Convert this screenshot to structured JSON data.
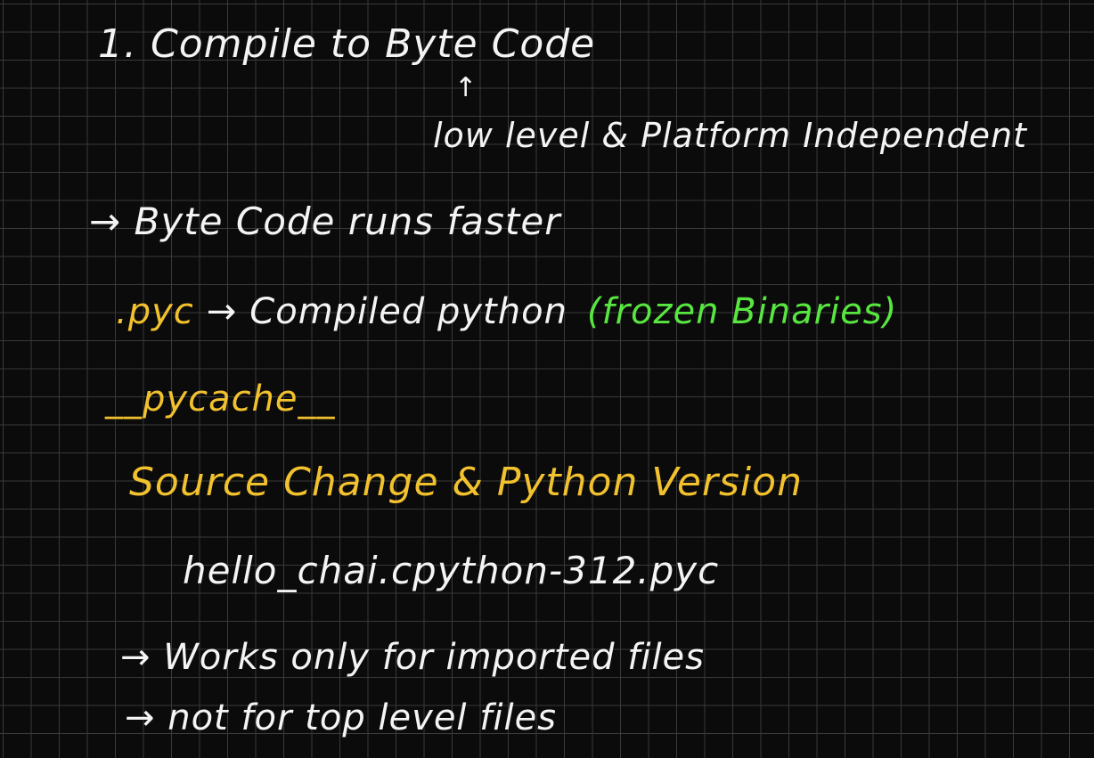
{
  "board": {
    "background_color": "#0b0b0b",
    "grid_color": "#3a3a3a",
    "colors": {
      "white": "#f4f4f4",
      "yellow": "#f2c12e",
      "green": "#58e640"
    }
  },
  "notes": {
    "line1": "1. Compile to Byte Code",
    "arrow_up": "↑",
    "line2": "low level & Platform Independent",
    "line3": "→ Byte Code runs faster",
    "line4_ext": ".pyc",
    "line4_arrow": "→",
    "line4_text": "Compiled python",
    "line4_green": "(frozen Binaries)",
    "line5": "__pycache__",
    "line6": "Source Change & Python Version",
    "line7": "hello_chai.cpython-312.pyc",
    "line8": "→ Works only for imported files",
    "line9": "→ not for top level files"
  }
}
